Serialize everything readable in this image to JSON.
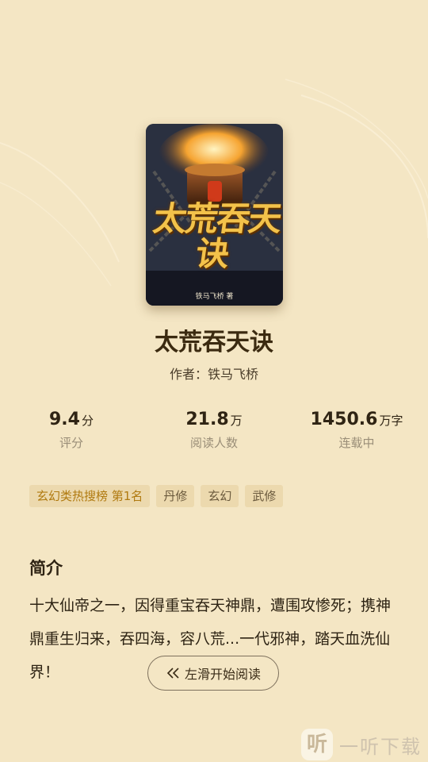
{
  "book": {
    "cover_art_title": "太荒吞天诀",
    "cover_author": "铁马飞桥 著",
    "title": "太荒吞天诀",
    "author_line": "作者：铁马飞桥"
  },
  "stats": [
    {
      "value": "9.4",
      "unit": "分",
      "label": "评分"
    },
    {
      "value": "21.8",
      "unit": "万",
      "label": "阅读人数"
    },
    {
      "value": "1450.6",
      "unit": "万字",
      "label": "连载中"
    }
  ],
  "tags": [
    "玄幻类热搜榜  第1名",
    "丹修",
    "玄幻",
    "武修"
  ],
  "intro": {
    "heading": "简介",
    "text": "十大仙帝之一，因得重宝吞天神鼎，遭围攻惨死；携神鼎重生归来，吞四海，容八荒...一代邪神，踏天血洗仙界！"
  },
  "swipe_button": {
    "label": "左滑开始阅读"
  },
  "watermark": {
    "logo": "听",
    "text": "一听下载"
  },
  "colors": {
    "background": "#f4e6c4",
    "tag_bg": "#ecd9ae",
    "rank_text": "#b07a10"
  }
}
